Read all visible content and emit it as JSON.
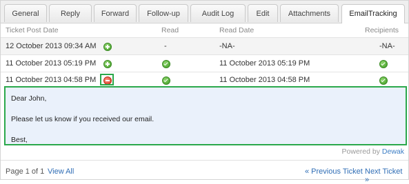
{
  "tabs": [
    {
      "label": "General",
      "active": false
    },
    {
      "label": "Reply",
      "active": false
    },
    {
      "label": "Forward",
      "active": false
    },
    {
      "label": "Follow-up",
      "active": false
    },
    {
      "label": "Audit Log",
      "active": false
    },
    {
      "label": "Edit",
      "active": false
    },
    {
      "label": "Attachments",
      "active": false
    },
    {
      "label": "EmailTracking",
      "active": true
    }
  ],
  "table": {
    "headers": {
      "post_date": "Ticket Post Date",
      "read": "Read",
      "read_date": "Read Date",
      "recipients": "Recipients"
    },
    "rows": [
      {
        "post_date": "12 October 2013 09:34 AM",
        "expand_icon": "plus-icon",
        "read": "-",
        "read_date": "-NA-",
        "recipients": "-NA-"
      },
      {
        "post_date": "11 October 2013 05:19 PM",
        "expand_icon": "plus-icon",
        "read_icon": "check-icon",
        "read_date": "11 October 2013 05:19 PM",
        "recipients_icon": "check-icon"
      },
      {
        "post_date": "11 October 2013 04:58 PM",
        "expand_icon": "minus-icon",
        "read_icon": "check-icon",
        "read_date": "11 October 2013 04:58 PM",
        "recipients_icon": "check-icon"
      }
    ]
  },
  "message": {
    "greeting": "Dear John,",
    "body": "Please let us know if you received our email.",
    "closing": "Best,"
  },
  "powered": {
    "prefix": "Powered by",
    "brand": "Dewak"
  },
  "footer": {
    "page_info": "Page 1 of 1",
    "view_all": "View All",
    "prev": "« Previous Ticket",
    "next": "Next Ticket »"
  },
  "colors": {
    "highlight": "#2aa84a",
    "link": "#2f6db5",
    "message_bg": "#eaf1fb"
  }
}
